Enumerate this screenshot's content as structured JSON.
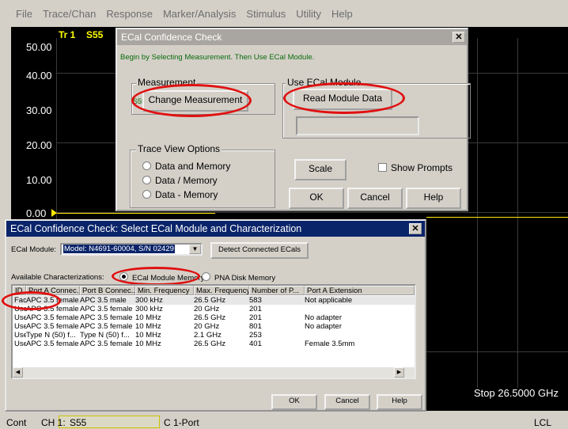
{
  "menubar": {
    "items": [
      "File",
      "Trace/Chan",
      "Response",
      "Marker/Analysis",
      "Stimulus",
      "Utility",
      "Help"
    ]
  },
  "analyzer": {
    "trace_label": "Tr 1",
    "trace_param": "S55",
    "y_ticks": [
      "50.00",
      "40.00",
      "30.00",
      "20.00",
      "10.00",
      "0.00"
    ],
    "stop_label": "Stop 26.5000 GHz"
  },
  "statusbar": {
    "mode": "Cont",
    "channel_prefix": "CH 1:",
    "channel_value": "S55",
    "port": "C 1-Port",
    "lcl": "LCL"
  },
  "confidence_dialog": {
    "title": "ECal Confidence Check",
    "instruction": "Begin by Selecting Measurement.  Then Use ECal Module.",
    "measurement_group": "Measurement",
    "measurement_prefix": "S55",
    "change_measurement": "Change Measurement",
    "use_ecal_group": "Use ECal Module",
    "read_module_data": "Read Module Data",
    "trace_view_group": "Trace View Options",
    "trace_options": [
      "Data and Memory",
      "Data / Memory",
      "Data - Memory"
    ],
    "scale": "Scale",
    "show_prompts": "Show Prompts",
    "ok": "OK",
    "cancel": "Cancel",
    "help": "Help",
    "accent_titlebar": "#a9a6a1"
  },
  "select_dialog": {
    "title": "ECal Confidence Check: Select ECal Module and Characterization",
    "module_label": "ECal Module:",
    "module_value": "Model: N4691-60004, S/N 02429",
    "detect": "Detect Connected ECals",
    "available_label": "Available Characterizations:",
    "memory_options": [
      "ECal Module Memory",
      "PNA Disk Memory"
    ],
    "columns": [
      "ID",
      "Port A Connec...",
      "Port B Connec...",
      "Min. Frequency",
      "Max. Frequency",
      "Number of P...",
      "Port A Extension"
    ],
    "rows": [
      [
        "Factory",
        "APC 3.5 female",
        "APC 3.5 male",
        "300 kHz",
        "26.5 GHz",
        "583",
        "Not applicable"
      ],
      [
        "User 1",
        "APC 3.5 female",
        "APC 3.5 female",
        "300 kHz",
        "20 GHz",
        "201",
        ""
      ],
      [
        "User 2",
        "APC 3.5 female",
        "APC 3.5 female",
        "10 MHz",
        "26.5 GHz",
        "201",
        "No adapter"
      ],
      [
        "User 3",
        "APC 3.5 female",
        "APC 3.5 female",
        "10 MHz",
        "20 GHz",
        "801",
        "No adapter"
      ],
      [
        "User 4",
        "Type N (50) f...",
        "Type N (50) f...",
        "10 MHz",
        "2.1 GHz",
        "253",
        ""
      ],
      [
        "User 5",
        "APC 3.5 female",
        "APC 3.5 female",
        "10 MHz",
        "26.5 GHz",
        "401",
        "Female 3.5mm"
      ]
    ],
    "ok": "OK",
    "cancel": "Cancel",
    "help": "Help",
    "accent_titlebar": "#0a246a"
  },
  "icons": {
    "close": "close-icon",
    "dropdown": "chevron-down-icon",
    "scroll_left": "arrow-left-icon",
    "scroll_right": "arrow-right-icon"
  },
  "colors": {
    "trace": "#ffe800",
    "highlight_ellipse": "#e01010"
  }
}
